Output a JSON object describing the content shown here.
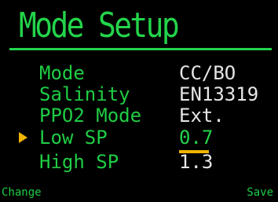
{
  "colors": {
    "title": "#23d44a",
    "label": "#1fcc44",
    "value_normal": "#e6e6e6",
    "value_selected": "#23d44a",
    "accent": "#f0b400",
    "softkey": "#1fcc44",
    "background": "#000000"
  },
  "header": {
    "title": "Mode Setup"
  },
  "settings": [
    {
      "label": "Mode",
      "value": "CC/BO",
      "selected": false
    },
    {
      "label": "Salinity",
      "value": "EN13319",
      "selected": false
    },
    {
      "label": "PPO2 Mode",
      "value": "Ext.",
      "selected": false
    },
    {
      "label": "Low SP",
      "value": "0.7",
      "selected": true,
      "editing": true
    },
    {
      "label": "High SP",
      "value": "1.3",
      "selected": false
    }
  ],
  "icons": {
    "selection_pointer": "right-triangle-icon"
  },
  "softkeys": {
    "left_label": "Change",
    "right_label": "Save"
  }
}
